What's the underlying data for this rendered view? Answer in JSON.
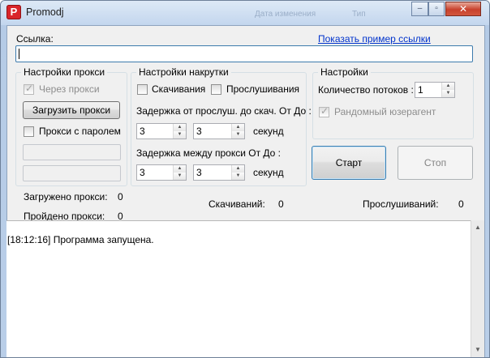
{
  "window": {
    "title": "Promodj",
    "icon": "P",
    "background_items": [
      "Дата изменения",
      "Тип"
    ],
    "controls": {
      "minimize": "‒",
      "maximize": "▫",
      "close": "✕"
    }
  },
  "url": {
    "label": "Ссылка:",
    "value": "",
    "example_link": "Показать пример ссылки"
  },
  "proxy_settings": {
    "title": "Настройки прокси",
    "use_proxy_label": "Через прокси",
    "use_proxy_checked": true,
    "load_button": "Загрузить прокси",
    "password_label": "Прокси с паролем",
    "password_checked": false,
    "login_value": "",
    "password_value": ""
  },
  "boost_settings": {
    "title": "Настройки накрутки",
    "downloads_label": "Скачивания",
    "downloads_checked": false,
    "plays_label": "Прослушивания",
    "plays_checked": false,
    "delay_play_label": "Задержка от прослуш. до скач. От До :",
    "delay_play_from": "3",
    "delay_play_to": "3",
    "delay_proxy_label": "Задержка  между прокси От До :",
    "delay_proxy_from": "3",
    "delay_proxy_to": "3",
    "seconds_label": "секунд"
  },
  "settings": {
    "title": "Настройки",
    "threads_label": "Количество потоков :",
    "threads_value": "1",
    "random_ua_label": "Рандомный юзерагент",
    "random_ua_checked": true
  },
  "actions": {
    "start": "Старт",
    "stop": "Стоп"
  },
  "stats": {
    "loaded_label": "Загружено прокси:",
    "loaded_value": "0",
    "passed_label": "Пройдено прокси:",
    "passed_value": "0",
    "downloads_label": "Скачиваний:",
    "downloads_value": "0",
    "plays_label": "Прослушиваний:",
    "plays_value": "0"
  },
  "log": {
    "lines": [
      "[18:12:16] Программа запущена."
    ]
  },
  "icons": {
    "up": "▲",
    "down": "▼"
  }
}
